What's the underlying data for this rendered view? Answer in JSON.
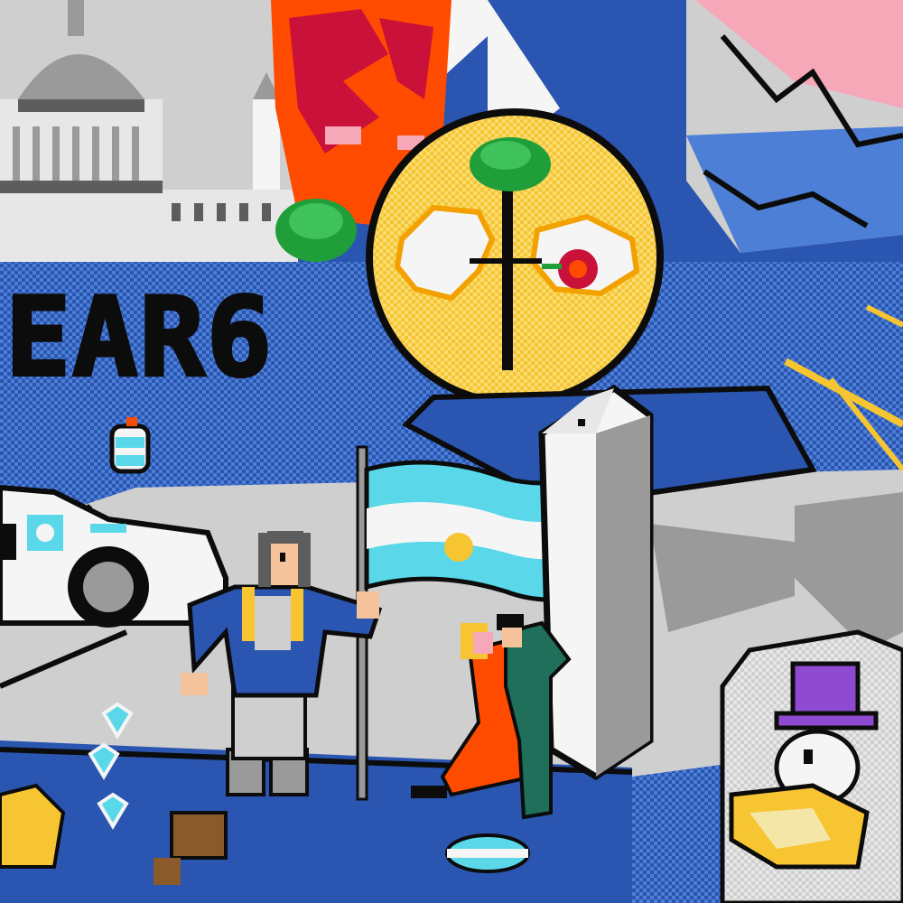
{
  "banner": {
    "text": "EAR6"
  },
  "colors": {
    "sky_blue": "#2a55b0",
    "dither_blue": "#4d7fd6",
    "light_blue": "#5ad8ea",
    "sun_yellow": "#f6c531",
    "white": "#f5f5f5",
    "grey": "#9a9a9a",
    "dark_grey": "#5d5d5d",
    "black": "#0c0c0c",
    "red": "#c9113a",
    "orange": "#ff4b00",
    "pink": "#f6a7b8",
    "green": "#1f9e3a",
    "purple": "#8e4ad0",
    "cream": "#f4e6a6"
  },
  "icons": [
    "capitol-dome-icon",
    "obelisk-icon",
    "argentina-flag-icon",
    "sun-emblem-icon",
    "islands-map-icon",
    "police-car-icon",
    "tango-dancers-icon",
    "general-figure-icon",
    "top-hat-character-icon",
    "heart-icons"
  ]
}
